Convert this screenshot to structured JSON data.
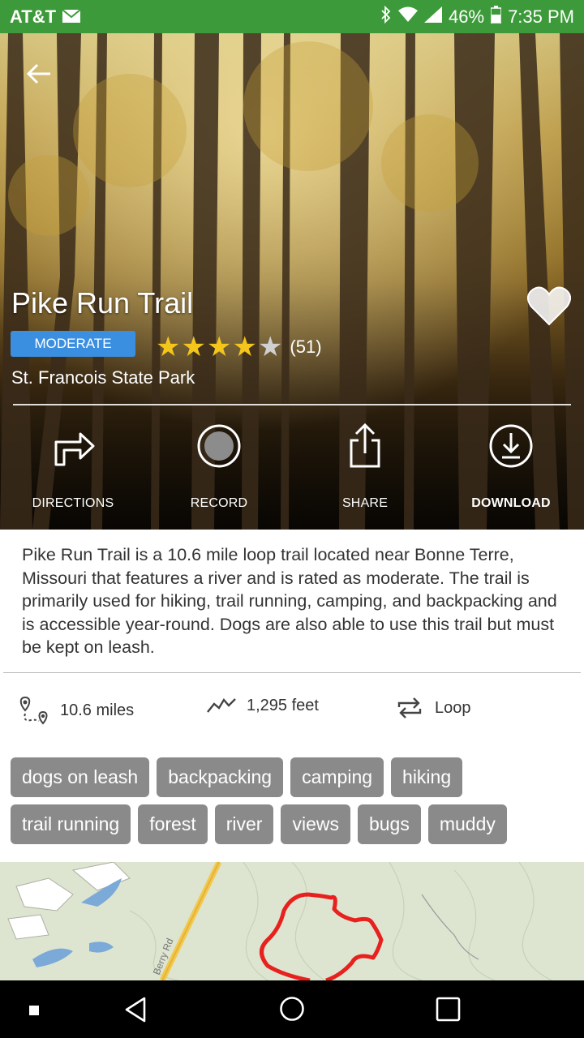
{
  "status": {
    "carrier": "AT&T",
    "battery": "46%",
    "time": "7:35 PM"
  },
  "trail": {
    "name": "Pike Run Trail",
    "difficulty": "MODERATE",
    "rating": 4,
    "max_rating": 5,
    "review_count": "(51)",
    "park": "St. Francois State Park"
  },
  "actions": [
    {
      "label": "DIRECTIONS",
      "icon": "directions-icon"
    },
    {
      "label": "RECORD",
      "icon": "record-icon"
    },
    {
      "label": "SHARE",
      "icon": "share-icon"
    },
    {
      "label": "DOWNLOAD",
      "icon": "download-icon"
    }
  ],
  "description": "Pike Run Trail is a 10.6 mile loop trail located near Bonne Terre, Missouri that features a river and is rated as moderate. The trail is primarily used for hiking, trail running, camping, and backpacking and is accessible year-round. Dogs are also able to use this trail but must be kept on leash.",
  "stats": {
    "distance": "10.6 miles",
    "elevation": "1,295 feet",
    "route_type": "Loop"
  },
  "tags": [
    [
      "dogs on leash",
      "backpacking",
      "camping",
      "hiking"
    ],
    [
      "trail running",
      "forest",
      "river",
      "views",
      "bugs",
      "muddy"
    ]
  ],
  "map": {
    "road_label": "Berry Rd"
  },
  "colors": {
    "status_bar": "#3d9a3a",
    "difficulty_badge": "#3b8fe0",
    "star": "#f4c51b",
    "tag": "#8a8a8a",
    "trail_line": "#e8201e"
  }
}
